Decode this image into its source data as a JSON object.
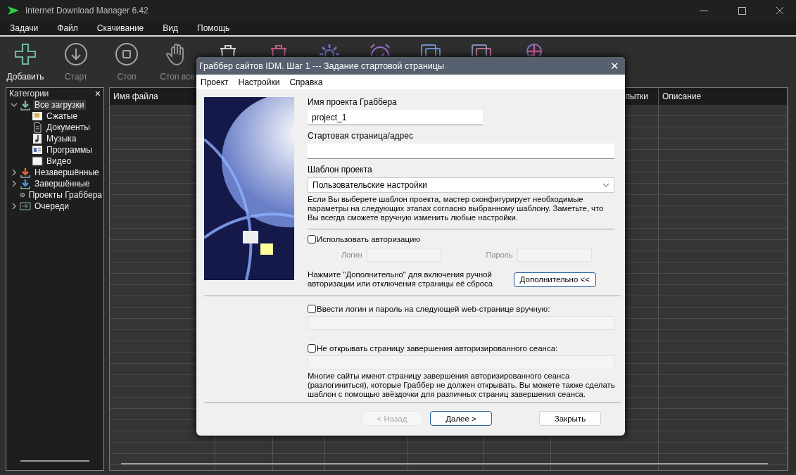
{
  "window": {
    "title": "Internet Download Manager 6.42"
  },
  "menu": [
    "Задачи",
    "Файл",
    "Скачивание",
    "Вид",
    "Помощь"
  ],
  "toolbar": [
    {
      "kind": "add",
      "label": "Добавить",
      "disabled": false
    },
    {
      "kind": "start",
      "label": "Старт",
      "disabled": true
    },
    {
      "kind": "stop",
      "label": "Стоп",
      "disabled": true
    },
    {
      "kind": "stop-all",
      "label": "Стоп все",
      "disabled": true
    },
    {
      "kind": "delete",
      "disabled": false
    },
    {
      "kind": "delete-completed",
      "disabled": false
    },
    {
      "kind": "options",
      "disabled": false
    },
    {
      "kind": "scheduler",
      "disabled": false
    },
    {
      "kind": "start-queue",
      "disabled": false
    },
    {
      "kind": "stop-queue",
      "disabled": false
    },
    {
      "kind": "grabber",
      "disabled": false
    }
  ],
  "sidebar": {
    "title": "Категории",
    "close": "×",
    "items": [
      {
        "label": "Все загрузки",
        "kind": "all",
        "expandable": true,
        "expanded": true,
        "selected": true,
        "children": [
          {
            "label": "Сжатые",
            "kind": "archive",
            "selected": false
          },
          {
            "label": "Документы",
            "kind": "document",
            "selected": false
          },
          {
            "label": "Музыка",
            "kind": "music",
            "selected": false
          },
          {
            "label": "Программы",
            "kind": "program",
            "selected": false
          },
          {
            "label": "Видео",
            "kind": "video",
            "selected": false
          }
        ]
      },
      {
        "label": "Незавершённые",
        "kind": "unfinished",
        "expandable": true,
        "expanded": false,
        "selected": false
      },
      {
        "label": "Завершённые",
        "kind": "finished",
        "expandable": true,
        "expanded": false,
        "selected": false
      },
      {
        "label": "Проекты Граббера",
        "kind": "grabber",
        "expandable": false,
        "selected": false
      },
      {
        "label": "Очереди",
        "kind": "queue",
        "expandable": true,
        "expanded": false,
        "selected": false
      }
    ]
  },
  "table": {
    "columns": [
      {
        "label": "Имя файла"
      },
      {},
      {},
      {},
      {},
      {},
      {
        "label": "пытки"
      },
      {
        "label": "Описание"
      }
    ]
  },
  "dialog": {
    "title": "Граббер сайтов IDM. Шаг 1 --- Задание стартовой страницы",
    "close": "✕",
    "menu": [
      "Проект",
      "Настройки",
      "Справка"
    ],
    "project_name": {
      "label": "Имя проекта Граббера",
      "value": "project_1"
    },
    "start_page": {
      "label": "Стартовая страница/адрес"
    },
    "template": {
      "label": "Шаблон проекта",
      "value": "Пользовательские настройки"
    },
    "template_note": "Если Вы выберете шаблон проекта, мастер сконфигурирует необходимые параметры на следующих этапах согласно выбранному шаблону. Заметьте, что Вы всегда сможете вручную изменить любые настройки.",
    "use_auth": {
      "label": "Использовать авторизацию",
      "checked": false
    },
    "login": {
      "label": "Логин",
      "disabled": true
    },
    "password": {
      "label": "Пароль",
      "disabled": true
    },
    "advanced_note": "Нажмите \"Дополнительно\" для включения ручной авторизации или отключения страницы её сброса",
    "advanced_button": "Дополнительно <<",
    "manual_login": {
      "label": "Ввести логин и пароль на следующей web-странице вручную:",
      "checked": false,
      "field_disabled": true
    },
    "no_logout": {
      "label": "Не открывать страницу завершения авторизированного сеанса:",
      "checked": false,
      "field_disabled": true
    },
    "logout_note": "Многие сайты имеют страницу завершения авторизированного сеанса (разлогиниться), которые Граббер не должен открывать.  Вы можете также сделать шаблон с помощью звёздочки для различных страниц завершения сеанса.",
    "buttons": [
      {
        "label": "< Назад",
        "disabled": true,
        "default": false
      },
      {
        "label": "Далее >",
        "disabled": false,
        "default": true
      },
      {
        "label": "Закрыть",
        "disabled": false,
        "default": false
      }
    ]
  }
}
